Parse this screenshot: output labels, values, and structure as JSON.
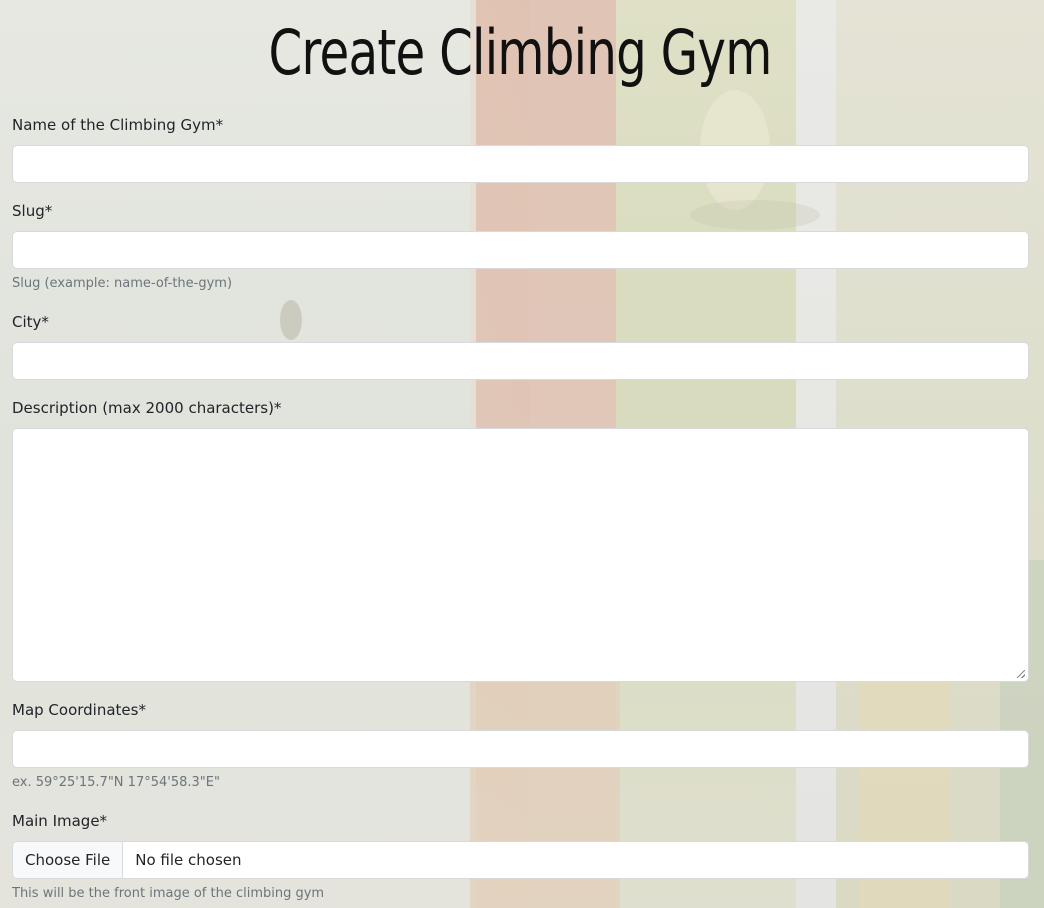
{
  "page": {
    "title": "Create Climbing Gym"
  },
  "form": {
    "name": {
      "label": "Name of the Climbing Gym*",
      "value": ""
    },
    "slug": {
      "label": "Slug*",
      "value": "",
      "help": "Slug (example: name-of-the-gym)"
    },
    "city": {
      "label": "City*",
      "value": ""
    },
    "description": {
      "label": "Description (max 2000 characters)*",
      "value": ""
    },
    "map_coordinates": {
      "label": "Map Coordinates*",
      "value": "",
      "help": "ex. 59°25'15.7\"N 17°54'58.3\"E\""
    },
    "main_image": {
      "label": "Main Image*",
      "button_label": "Choose File",
      "status": "No file chosen",
      "help": "This will be the front image of the climbing gym"
    }
  }
}
